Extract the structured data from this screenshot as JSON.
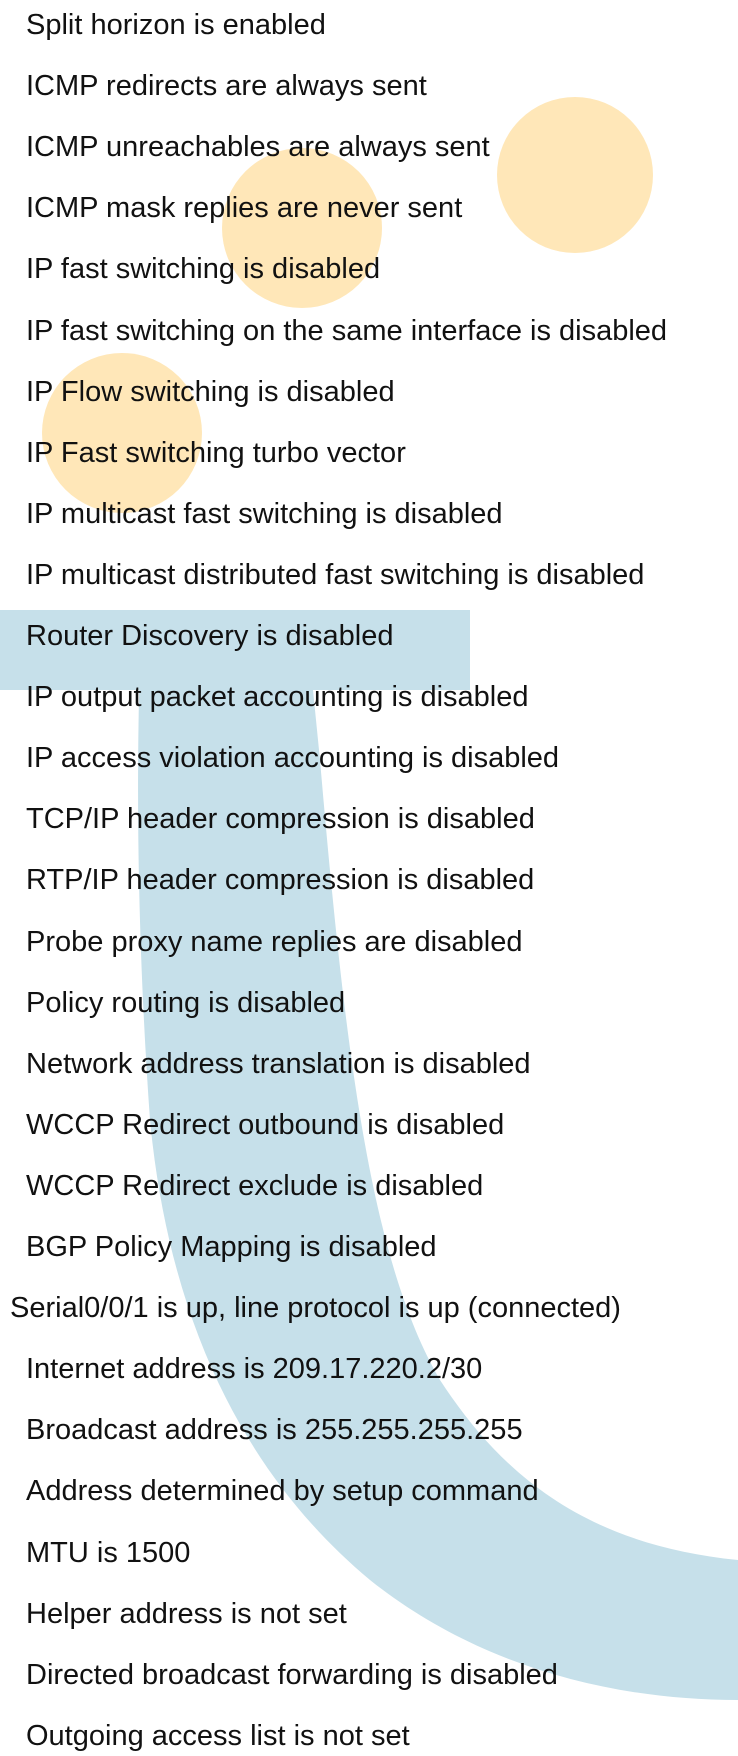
{
  "colors": {
    "background": "#ffffff",
    "text": "#111111",
    "watermark_blue": "#c6e0ea",
    "watermark_orange": "#ffe7b8"
  },
  "lines": [
    {
      "text": "Split horizon is enabled",
      "outdent": false
    },
    {
      "text": "ICMP redirects are always sent",
      "outdent": false
    },
    {
      "text": "ICMP unreachables are always sent",
      "outdent": false
    },
    {
      "text": "ICMP mask replies are never sent",
      "outdent": false
    },
    {
      "text": "IP fast switching is disabled",
      "outdent": false
    },
    {
      "text": "IP fast switching on the same interface is disabled",
      "outdent": false
    },
    {
      "text": "IP Flow switching is disabled",
      "outdent": false
    },
    {
      "text": "IP Fast switching turbo vector",
      "outdent": false
    },
    {
      "text": "IP multicast fast switching is disabled",
      "outdent": false
    },
    {
      "text": "IP multicast distributed fast switching is disabled",
      "outdent": false
    },
    {
      "text": "Router Discovery is disabled",
      "outdent": false
    },
    {
      "text": "IP output packet accounting is disabled",
      "outdent": false
    },
    {
      "text": "IP access violation accounting is disabled",
      "outdent": false
    },
    {
      "text": "TCP/IP header compression is disabled",
      "outdent": false
    },
    {
      "text": "RTP/IP header compression is disabled",
      "outdent": false
    },
    {
      "text": "Probe proxy name replies are disabled",
      "outdent": false
    },
    {
      "text": "Policy routing is disabled",
      "outdent": false
    },
    {
      "text": "Network address translation is disabled",
      "outdent": false
    },
    {
      "text": "WCCP Redirect outbound is disabled",
      "outdent": false
    },
    {
      "text": "WCCP Redirect exclude is disabled",
      "outdent": false
    },
    {
      "text": "BGP Policy Mapping is disabled",
      "outdent": false
    },
    {
      "text": "Serial0/0/1 is up, line protocol is up (connected)",
      "outdent": true
    },
    {
      "text": "Internet address is 209.17.220.2/30",
      "outdent": false
    },
    {
      "text": "Broadcast address is 255.255.255.255",
      "outdent": false
    },
    {
      "text": "Address determined by setup command",
      "outdent": false
    },
    {
      "text": "MTU is 1500",
      "outdent": false
    },
    {
      "text": "Helper address is not set",
      "outdent": false
    },
    {
      "text": "Directed broadcast forwarding is disabled",
      "outdent": false
    },
    {
      "text": "Outgoing access list is not set",
      "outdent": false
    }
  ]
}
